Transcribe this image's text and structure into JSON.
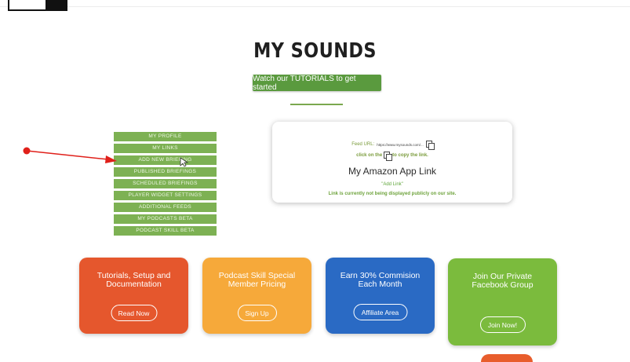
{
  "page": {
    "title": "MY SOUNDS",
    "tutorials_button": "Watch our TUTORIALS to get started"
  },
  "side_menu": {
    "items": [
      {
        "label": "MY PROFILE"
      },
      {
        "label": "MY LINKS"
      },
      {
        "label": "ADD NEW BRIEFING"
      },
      {
        "label": "PUBLISHED BRIEFINGS"
      },
      {
        "label": "SCHEDULED BRIEFINGS"
      },
      {
        "label": "PLAYER WIDGET SETTINGS"
      },
      {
        "label": "ADDITIONAL FEEDS"
      },
      {
        "label": "MY PODCASTS BETA"
      },
      {
        "label": "PODCAST SKILL BETA"
      }
    ]
  },
  "feed_card": {
    "feed_label": "Feed URL:",
    "feed_url": "https://www.mysounds.com/...",
    "copy_before": "click on the",
    "copy_after": "to copy the link.",
    "amazon_title": "My Amazon App Link",
    "add_link": "\"Add Link\"",
    "not_displayed": "Link is currently not being displayed publicly on our site."
  },
  "cards": [
    {
      "title": "Tutorials, Setup and Documentation",
      "button": "Read Now",
      "color": "#e5572d"
    },
    {
      "title": "Podcast Skill Special Member Pricing",
      "button": "Sign Up",
      "color": "#f6a93a"
    },
    {
      "title": "Earn 30% Commision Each Month",
      "button": "Affiliate Area",
      "color": "#2a6ac4"
    },
    {
      "title": "Join Our Private Facebook Group",
      "button": "Join Now!",
      "color": "#7bbb3d"
    }
  ],
  "annotation": {
    "arrow_color": "#e0201a",
    "arrow_target": "ADD NEW BRIEFING"
  }
}
